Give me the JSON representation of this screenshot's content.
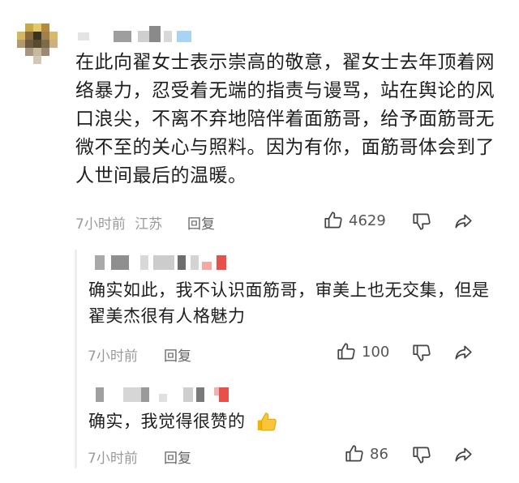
{
  "main_comment": {
    "text": "在此向翟女士表示崇高的敬意，翟女士去年顶着网络暴力，忍受着无端的指责与谩骂，站在舆论的风口浪尖，不离不弃地陪伴着面筋哥，给予面筋哥无微不至的关心与照料。因为有你，面筋哥体会到了人世间最后的温暖。",
    "time": "7小时前",
    "location": "江苏",
    "reply_label": "回复",
    "likes": "4629"
  },
  "replies": [
    {
      "text": "确实如此，我不认识面筋哥，审美上也无交集，但是翟美杰很有人格魅力",
      "time": "7小时前",
      "reply_label": "回复",
      "likes": "100"
    },
    {
      "text": "确实，我觉得很赞的",
      "emoji": "👍",
      "time": "7小时前",
      "reply_label": "回复",
      "likes": "86"
    }
  ],
  "colors": {
    "accent": "#e8504a",
    "muted": "#9a9a9a",
    "text": "#1e1e1e"
  },
  "icons": [
    "thumbs-up-icon",
    "thumbs-down-icon",
    "share-icon"
  ]
}
